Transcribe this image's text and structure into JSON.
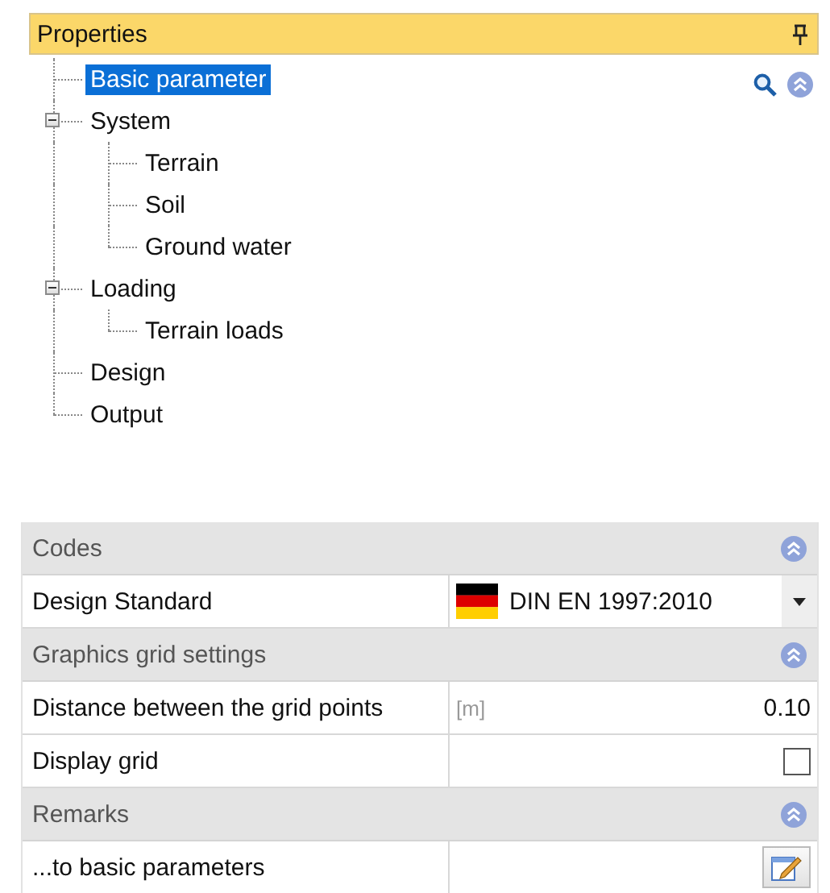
{
  "panel": {
    "title": "Properties",
    "pinned": true
  },
  "tree": [
    {
      "label": "Basic parameter",
      "selected": true
    },
    {
      "label": "System",
      "selected": false,
      "expanded": true,
      "children": [
        {
          "label": "Terrain",
          "selected": false
        },
        {
          "label": "Soil",
          "selected": false
        },
        {
          "label": "Ground water",
          "selected": false
        }
      ]
    },
    {
      "label": "Loading",
      "selected": false,
      "expanded": true,
      "children": [
        {
          "label": "Terrain loads",
          "selected": false
        }
      ]
    },
    {
      "label": "Design",
      "selected": false
    },
    {
      "label": "Output",
      "selected": false
    }
  ],
  "sections": [
    {
      "title": "Codes",
      "expanded": true,
      "rows": [
        {
          "kind": "dropdown",
          "label": "Design Standard",
          "value": "DIN EN 1997:2010"
        }
      ]
    },
    {
      "title": "Graphics grid settings",
      "expanded": true,
      "rows": [
        {
          "kind": "number",
          "label": "Distance between the grid points",
          "unit": "[m]",
          "value": "0.10"
        },
        {
          "kind": "checkbox",
          "label": "Display grid",
          "checked": false
        }
      ]
    },
    {
      "title": "Remarks",
      "expanded": true,
      "rows": [
        {
          "kind": "button",
          "label": "...to basic parameters"
        }
      ]
    }
  ]
}
